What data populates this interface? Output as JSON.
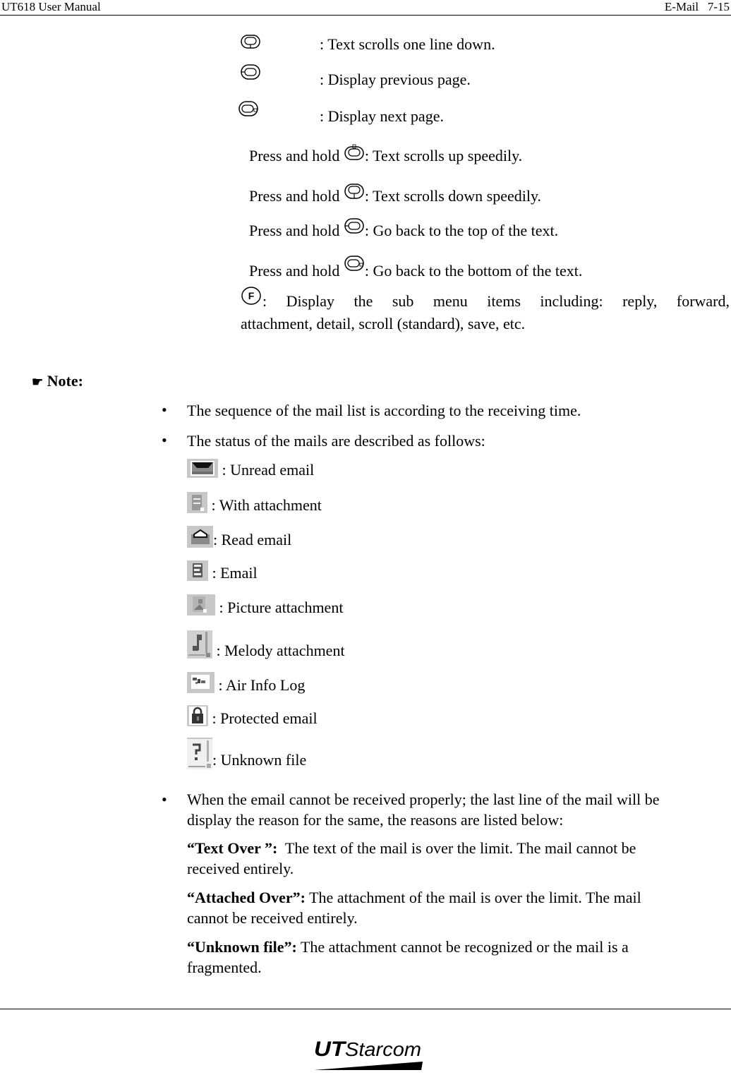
{
  "header": {
    "left": "UT618 User Manual",
    "right": "E-Mail   7-15"
  },
  "key_rows": [
    {
      "icon": "down-key-icon",
      "text": ": Text scrolls one line down."
    },
    {
      "icon": "left-key-icon",
      "text": ": Display previous page."
    },
    {
      "icon": "right-key-icon",
      "text": ": Display next page."
    }
  ],
  "hold_rows": [
    {
      "prefix": "Press and hold ",
      "icon": "up-key-icon",
      "text": ": Text scrolls up speedily."
    },
    {
      "prefix": "Press and hold ",
      "icon": "down-key-icon",
      "text": ": Text scrolls down speedily."
    },
    {
      "prefix": "Press and hold ",
      "icon": "left-key-icon",
      "text": ": Go back to the top of the text."
    },
    {
      "prefix": "Press and hold ",
      "icon": "right-key-icon",
      "text": ": Go back to the bottom of the text."
    }
  ],
  "f_key": {
    "line1": ": Display the sub menu items including: reply, forward,",
    "line2": "attachment, detail, scroll (standard), save, etc."
  },
  "note": {
    "icon": "pointing-hand-icon",
    "label": "Note:"
  },
  "bullets": [
    "The sequence of the mail list is according to the receiving time.",
    "The status of the mails are described as follows:"
  ],
  "status_icons": [
    {
      "icon": "unread-email-icon",
      "label": " : Unread email"
    },
    {
      "icon": "with-attachment-icon",
      "label": " : With attachment"
    },
    {
      "icon": "read-email-icon",
      "label": ": Read email"
    },
    {
      "icon": "email-icon",
      "label": " : Email"
    },
    {
      "icon": "picture-attachment-icon",
      "label": " : Picture attachment"
    },
    {
      "icon": "melody-attachment-icon",
      "label": " : Melody attachment"
    },
    {
      "icon": "air-info-log-icon",
      "label": " : Air Info Log"
    },
    {
      "icon": "protected-email-icon",
      "label": " : Protected email"
    },
    {
      "icon": "unknown-file-icon",
      "label": ": Unknown file"
    }
  ],
  "error_bullet": {
    "line1": "When the email cannot be received properly; the last line of the mail will be",
    "line2": "display the reason for the same, the reasons are listed below:"
  },
  "reasons": [
    {
      "term": "“Text Over ”:",
      "line1": "  The text of the mail is over the limit. The mail cannot be",
      "line2": "received entirely."
    },
    {
      "term": "“Attached Over”:",
      "line1": " The attachment of the mail is over the limit. The mail",
      "line2": "cannot be received entirely."
    },
    {
      "term": "“Unknown file”:",
      "line1": " The attachment cannot be recognized or the mail is a",
      "line2": "fragmented."
    }
  ],
  "footer": {
    "logo_text": "UTStarcom"
  }
}
